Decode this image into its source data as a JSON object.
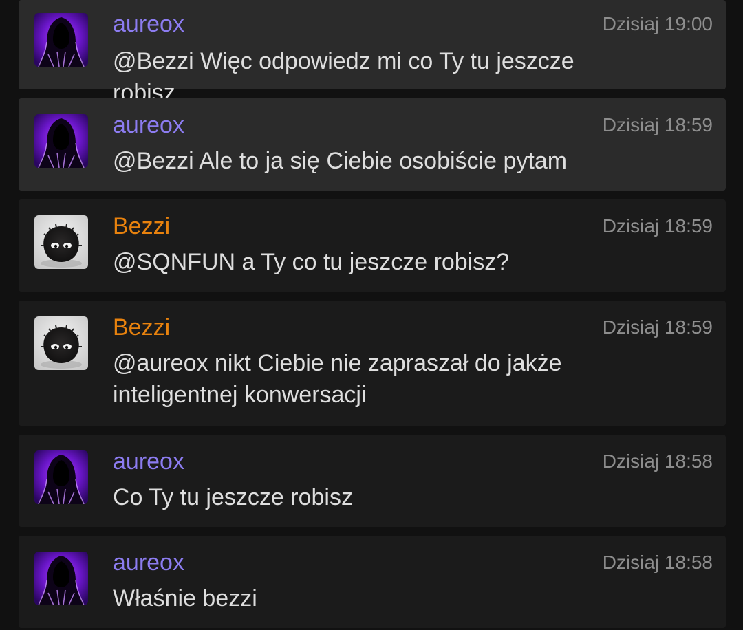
{
  "colors": {
    "author_purple": "#8c7cf0",
    "author_orange": "#e8820e",
    "message_text": "#dedede",
    "timestamp": "#8e8e8e"
  },
  "messages": [
    {
      "author": "aureox",
      "author_color": "#8c7cf0",
      "avatar": "hooded-figure-avatar",
      "time": "Dzisiaj 19:00",
      "text": "@Bezzi Więc odpowiedz mi co Ty tu jeszcze robisz",
      "highlighted": true
    },
    {
      "author": "aureox",
      "author_color": "#8c7cf0",
      "avatar": "hooded-figure-avatar",
      "time": "Dzisiaj 18:59",
      "text": "@Bezzi Ale to ja się Ciebie osobiście pytam",
      "highlighted": true
    },
    {
      "author": "Bezzi",
      "author_color": "#e8820e",
      "avatar": "fluffy-creature-avatar",
      "time": "Dzisiaj 18:59",
      "text": "@SQNFUN a Ty co tu jeszcze robisz?",
      "highlighted": false
    },
    {
      "author": "Bezzi",
      "author_color": "#e8820e",
      "avatar": "fluffy-creature-avatar",
      "time": "Dzisiaj 18:59",
      "text": "@aureox nikt Ciebie nie zapraszał do jakże inteligentnej konwersacji",
      "highlighted": false
    },
    {
      "author": "aureox",
      "author_color": "#8c7cf0",
      "avatar": "hooded-figure-avatar",
      "time": "Dzisiaj 18:58",
      "text": "Co Ty tu jeszcze robisz",
      "highlighted": false
    },
    {
      "author": "aureox",
      "author_color": "#8c7cf0",
      "avatar": "hooded-figure-avatar",
      "time": "Dzisiaj 18:58",
      "text": "Właśnie bezzi",
      "highlighted": false
    }
  ]
}
